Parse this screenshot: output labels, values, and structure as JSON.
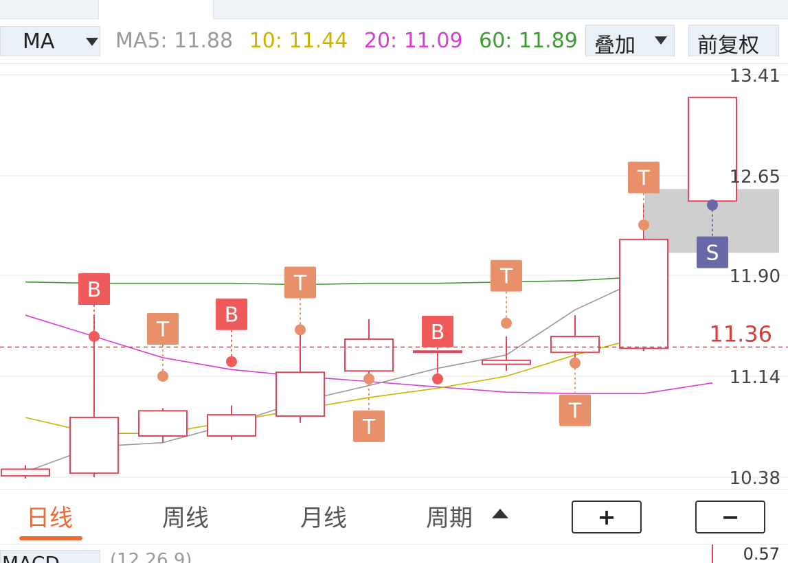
{
  "header": {
    "indicator_select": "MA",
    "ma_values": [
      {
        "label": "MA5:",
        "value": "11.88",
        "color": "#999999"
      },
      {
        "label": "10:",
        "value": "11.44",
        "color": "#c8b400"
      },
      {
        "label": "20:",
        "value": "11.09",
        "color": "#d83cd0"
      },
      {
        "label": "60:",
        "value": "11.89",
        "color": "#3b9b2e"
      }
    ],
    "overlay_button": "叠加",
    "adjust_button": "前复权"
  },
  "chart_data": {
    "type": "candlestick",
    "y_ticks": [
      "13.41",
      "12.65",
      "11.90",
      "11.14",
      "10.38"
    ],
    "ylim": [
      10.38,
      13.41
    ],
    "current_price": "11.36",
    "colors": {
      "up": "#e0475a",
      "down": "#0aa56e",
      "ma5": "#999999",
      "ma10": "#c8b400",
      "ma20": "#d83cd0",
      "ma60": "#3b9b2e",
      "current": "#d43b3b"
    },
    "candles": [
      {
        "open": 10.39,
        "close": 10.44,
        "high": 10.47,
        "low": 10.37
      },
      {
        "open": 10.41,
        "close": 10.83,
        "high": 11.59,
        "low": 10.38
      },
      {
        "open": 10.69,
        "close": 10.88,
        "high": 10.9,
        "low": 10.64
      },
      {
        "open": 10.69,
        "close": 10.85,
        "high": 10.92,
        "low": 10.66
      },
      {
        "open": 10.84,
        "close": 11.17,
        "high": 11.47,
        "low": 10.79
      },
      {
        "open": 11.18,
        "close": 11.42,
        "high": 11.57,
        "low": 11.12
      },
      {
        "open": 11.33,
        "close": 11.33,
        "high": 11.33,
        "low": 11.17
      },
      {
        "open": 11.23,
        "close": 11.26,
        "high": 11.44,
        "low": 11.18
      },
      {
        "open": 11.32,
        "close": 11.44,
        "high": 11.6,
        "low": 11.19
      },
      {
        "open": 11.35,
        "close": 12.17,
        "high": 12.43,
        "low": 11.33
      },
      {
        "open": 12.46,
        "close": 13.24,
        "high": 13.24,
        "low": 12.43
      }
    ],
    "ma5": [
      10.42,
      10.61,
      10.64,
      10.78,
      10.95,
      11.07,
      11.2,
      11.3,
      11.64,
      11.88
    ],
    "ma10": [
      10.83,
      10.71,
      10.71,
      10.8,
      10.89,
      10.98,
      11.05,
      11.14,
      11.3,
      11.44
    ],
    "ma20": [
      11.6,
      11.44,
      11.28,
      11.19,
      11.14,
      11.1,
      11.06,
      11.02,
      11.01,
      11.01,
      11.09
    ],
    "ma60": [
      11.85,
      11.84,
      11.84,
      11.84,
      11.83,
      11.84,
      11.84,
      11.85,
      11.86,
      11.89
    ],
    "markers": [
      {
        "candle": 1,
        "type": "B",
        "price": 11.44
      },
      {
        "candle": 2,
        "type": "T",
        "price": 11.14
      },
      {
        "candle": 3,
        "type": "B",
        "price": 11.25
      },
      {
        "candle": 4,
        "type": "T",
        "price": 11.49
      },
      {
        "candle": 5,
        "type": "T",
        "price": 11.12
      },
      {
        "candle": 6,
        "type": "B",
        "price": 11.12
      },
      {
        "candle": 7,
        "type": "T",
        "price": 11.54
      },
      {
        "candle": 8,
        "type": "T",
        "price": 11.24
      },
      {
        "candle": 9,
        "type": "T",
        "price": 12.28
      },
      {
        "candle": 10,
        "type": "S",
        "price": 12.43
      }
    ],
    "marker_colors": {
      "B": "#f05a5a",
      "T": "#e8906a",
      "S": "#6a69a8"
    }
  },
  "footer": {
    "period_tabs": [
      "日线",
      "周线",
      "月线",
      "周期"
    ],
    "zoom_in": "+",
    "zoom_out": "−"
  },
  "macd": {
    "indicator_select": "MACD",
    "params": "(12,26,9)",
    "value": "0.57"
  }
}
